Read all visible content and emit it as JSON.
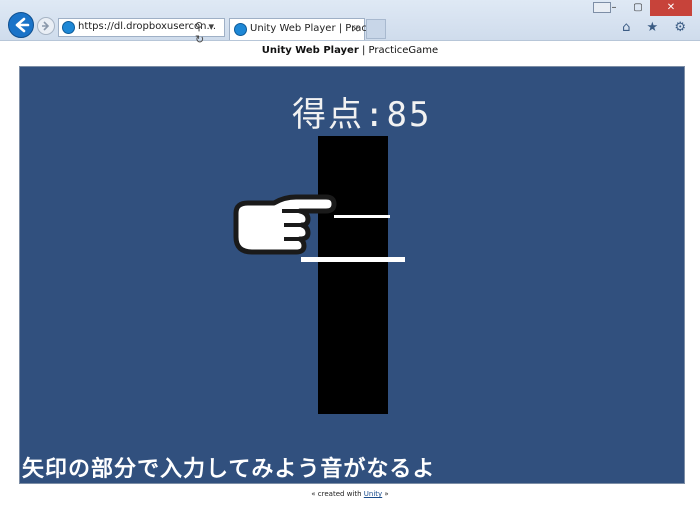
{
  "browser": {
    "url": "https://dl.dropboxusercon...",
    "addr_icons": "⚲ ▾ ↻",
    "tab_title": "Unity Web Player | Pract...",
    "tab_close": "×",
    "win_minimize": "–",
    "win_maximize": "▢",
    "win_close": "✕",
    "toolbar_icons": "⌂ ★ ⚙"
  },
  "page": {
    "title_bold": "Unity Web Player",
    "title_rest": " | PracticeGame"
  },
  "game": {
    "score_text": "得点:85",
    "instruction": "矢印の部分で入力してみよう音がなるよ"
  },
  "footer": {
    "prefix": "« created with ",
    "link": "Unity",
    "suffix": " »"
  },
  "colors": {
    "player_bg": "#31507e",
    "column": "#000000",
    "text": "#ffffff"
  }
}
